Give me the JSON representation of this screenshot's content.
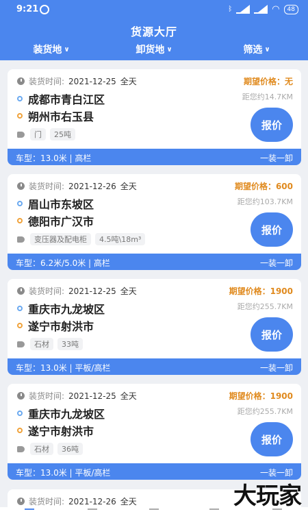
{
  "status": {
    "time": "9:21",
    "network": "HD 4G",
    "battery": "48"
  },
  "header": {
    "title": "货源大厅"
  },
  "filters": [
    {
      "label": "装货地"
    },
    {
      "label": "卸货地"
    },
    {
      "label": "筛选"
    }
  ],
  "common": {
    "time_label": "装货时间:",
    "quote_label": "报价"
  },
  "cards": [
    {
      "date": "2021-12-25",
      "period": "全天",
      "price": "期望价格：无",
      "distance": "距您约14.7KM",
      "from": "成都市青白江区",
      "to": "朔州市右玉县",
      "tags": [
        "门",
        "25吨"
      ],
      "vehicle": "车型：13.0米 | 高栏",
      "mode": "一装一卸"
    },
    {
      "date": "2021-12-26",
      "period": "全天",
      "price": "期望价格：600",
      "distance": "距您约103.7KM",
      "from": "眉山市东坡区",
      "to": "德阳市广汉市",
      "tags": [
        "变压器及配电柜",
        "4.5吨\\18m³"
      ],
      "vehicle": "车型：6.2米/5.0米 | 高栏",
      "mode": "一装一卸"
    },
    {
      "date": "2021-12-25",
      "period": "全天",
      "price": "期望价格：1900",
      "distance": "距您约255.7KM",
      "from": "重庆市九龙坡区",
      "to": "遂宁市射洪市",
      "tags": [
        "石材",
        "33吨"
      ],
      "vehicle": "车型：13.0米 | 平板/高栏",
      "mode": "一装一卸"
    },
    {
      "date": "2021-12-25",
      "period": "全天",
      "price": "期望价格：1900",
      "distance": "距您约255.7KM",
      "from": "重庆市九龙坡区",
      "to": "遂宁市射洪市",
      "tags": [
        "石材",
        "36吨"
      ],
      "vehicle": "车型：13.0米 | 平板/高栏",
      "mode": "一装一卸"
    }
  ],
  "peek": {
    "date": "2021-12-26",
    "period": "全天"
  },
  "watermark": "大玩家"
}
